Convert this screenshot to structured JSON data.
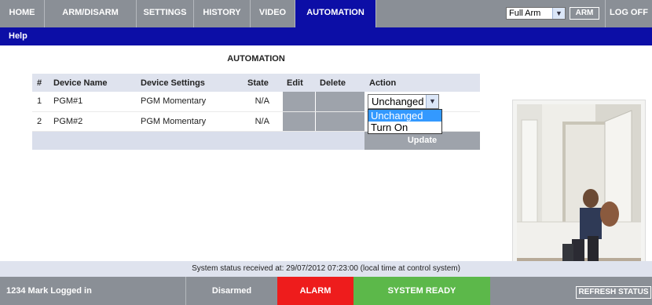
{
  "nav": {
    "items": [
      {
        "label": "HOME"
      },
      {
        "label": "ARM/DISARM"
      },
      {
        "label": "SETTINGS"
      },
      {
        "label": "HISTORY"
      },
      {
        "label": "VIDEO"
      },
      {
        "label": "AUTOMATION",
        "active": true
      }
    ],
    "arm_mode_selected": "Full Arm",
    "arm_button": "ARM",
    "logoff": "LOG OFF"
  },
  "help": "Help",
  "page_title": "AUTOMATION",
  "table": {
    "headers": [
      "#",
      "Device Name",
      "Device Settings",
      "State",
      "Edit",
      "Delete",
      "Action"
    ],
    "rows": [
      {
        "num": "1",
        "name": "PGM#1",
        "settings": "PGM Momentary",
        "state": "N/A",
        "action": "Unchanged"
      },
      {
        "num": "2",
        "name": "PGM#2",
        "settings": "PGM Momentary",
        "state": "N/A",
        "action": ""
      }
    ],
    "update_button": "Update"
  },
  "action_dropdown": {
    "options": [
      "Unchanged",
      "Turn On"
    ],
    "highlighted": "Unchanged"
  },
  "status_line": "System status received at: 29/07/2012 07:23:00 (local time at control system)",
  "bottom": {
    "user": "1234 Mark Logged in",
    "arm_state": "Disarmed",
    "alarm": "ALARM",
    "system": "SYSTEM READY",
    "refresh": "REFRESH STATUS"
  },
  "colors": {
    "nav_bg": "#8a8f96",
    "accent_blue": "#0c0ea6",
    "alarm_red": "#ee1c1c",
    "ready_green": "#5cb84a"
  }
}
